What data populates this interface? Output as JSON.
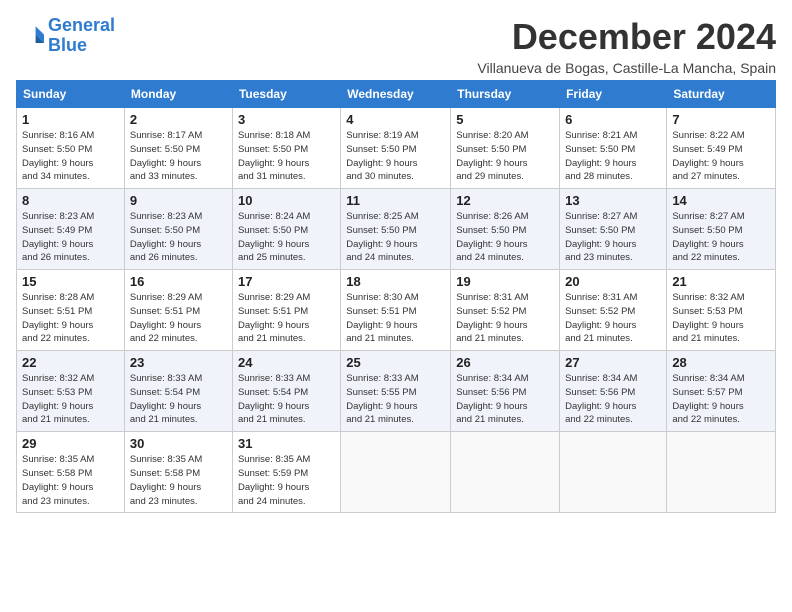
{
  "logo": {
    "line1": "General",
    "line2": "Blue"
  },
  "title": "December 2024",
  "subtitle": "Villanueva de Bogas, Castille-La Mancha, Spain",
  "weekdays": [
    "Sunday",
    "Monday",
    "Tuesday",
    "Wednesday",
    "Thursday",
    "Friday",
    "Saturday"
  ],
  "weeks": [
    [
      {
        "day": "1",
        "info": "Sunrise: 8:16 AM\nSunset: 5:50 PM\nDaylight: 9 hours\nand 34 minutes."
      },
      {
        "day": "2",
        "info": "Sunrise: 8:17 AM\nSunset: 5:50 PM\nDaylight: 9 hours\nand 33 minutes."
      },
      {
        "day": "3",
        "info": "Sunrise: 8:18 AM\nSunset: 5:50 PM\nDaylight: 9 hours\nand 31 minutes."
      },
      {
        "day": "4",
        "info": "Sunrise: 8:19 AM\nSunset: 5:50 PM\nDaylight: 9 hours\nand 30 minutes."
      },
      {
        "day": "5",
        "info": "Sunrise: 8:20 AM\nSunset: 5:50 PM\nDaylight: 9 hours\nand 29 minutes."
      },
      {
        "day": "6",
        "info": "Sunrise: 8:21 AM\nSunset: 5:50 PM\nDaylight: 9 hours\nand 28 minutes."
      },
      {
        "day": "7",
        "info": "Sunrise: 8:22 AM\nSunset: 5:49 PM\nDaylight: 9 hours\nand 27 minutes."
      }
    ],
    [
      {
        "day": "8",
        "info": "Sunrise: 8:23 AM\nSunset: 5:49 PM\nDaylight: 9 hours\nand 26 minutes."
      },
      {
        "day": "9",
        "info": "Sunrise: 8:23 AM\nSunset: 5:50 PM\nDaylight: 9 hours\nand 26 minutes."
      },
      {
        "day": "10",
        "info": "Sunrise: 8:24 AM\nSunset: 5:50 PM\nDaylight: 9 hours\nand 25 minutes."
      },
      {
        "day": "11",
        "info": "Sunrise: 8:25 AM\nSunset: 5:50 PM\nDaylight: 9 hours\nand 24 minutes."
      },
      {
        "day": "12",
        "info": "Sunrise: 8:26 AM\nSunset: 5:50 PM\nDaylight: 9 hours\nand 24 minutes."
      },
      {
        "day": "13",
        "info": "Sunrise: 8:27 AM\nSunset: 5:50 PM\nDaylight: 9 hours\nand 23 minutes."
      },
      {
        "day": "14",
        "info": "Sunrise: 8:27 AM\nSunset: 5:50 PM\nDaylight: 9 hours\nand 22 minutes."
      }
    ],
    [
      {
        "day": "15",
        "info": "Sunrise: 8:28 AM\nSunset: 5:51 PM\nDaylight: 9 hours\nand 22 minutes."
      },
      {
        "day": "16",
        "info": "Sunrise: 8:29 AM\nSunset: 5:51 PM\nDaylight: 9 hours\nand 22 minutes."
      },
      {
        "day": "17",
        "info": "Sunrise: 8:29 AM\nSunset: 5:51 PM\nDaylight: 9 hours\nand 21 minutes."
      },
      {
        "day": "18",
        "info": "Sunrise: 8:30 AM\nSunset: 5:51 PM\nDaylight: 9 hours\nand 21 minutes."
      },
      {
        "day": "19",
        "info": "Sunrise: 8:31 AM\nSunset: 5:52 PM\nDaylight: 9 hours\nand 21 minutes."
      },
      {
        "day": "20",
        "info": "Sunrise: 8:31 AM\nSunset: 5:52 PM\nDaylight: 9 hours\nand 21 minutes."
      },
      {
        "day": "21",
        "info": "Sunrise: 8:32 AM\nSunset: 5:53 PM\nDaylight: 9 hours\nand 21 minutes."
      }
    ],
    [
      {
        "day": "22",
        "info": "Sunrise: 8:32 AM\nSunset: 5:53 PM\nDaylight: 9 hours\nand 21 minutes."
      },
      {
        "day": "23",
        "info": "Sunrise: 8:33 AM\nSunset: 5:54 PM\nDaylight: 9 hours\nand 21 minutes."
      },
      {
        "day": "24",
        "info": "Sunrise: 8:33 AM\nSunset: 5:54 PM\nDaylight: 9 hours\nand 21 minutes."
      },
      {
        "day": "25",
        "info": "Sunrise: 8:33 AM\nSunset: 5:55 PM\nDaylight: 9 hours\nand 21 minutes."
      },
      {
        "day": "26",
        "info": "Sunrise: 8:34 AM\nSunset: 5:56 PM\nDaylight: 9 hours\nand 21 minutes."
      },
      {
        "day": "27",
        "info": "Sunrise: 8:34 AM\nSunset: 5:56 PM\nDaylight: 9 hours\nand 22 minutes."
      },
      {
        "day": "28",
        "info": "Sunrise: 8:34 AM\nSunset: 5:57 PM\nDaylight: 9 hours\nand 22 minutes."
      }
    ],
    [
      {
        "day": "29",
        "info": "Sunrise: 8:35 AM\nSunset: 5:58 PM\nDaylight: 9 hours\nand 23 minutes."
      },
      {
        "day": "30",
        "info": "Sunrise: 8:35 AM\nSunset: 5:58 PM\nDaylight: 9 hours\nand 23 minutes."
      },
      {
        "day": "31",
        "info": "Sunrise: 8:35 AM\nSunset: 5:59 PM\nDaylight: 9 hours\nand 24 minutes."
      },
      {
        "day": "",
        "info": ""
      },
      {
        "day": "",
        "info": ""
      },
      {
        "day": "",
        "info": ""
      },
      {
        "day": "",
        "info": ""
      }
    ]
  ]
}
